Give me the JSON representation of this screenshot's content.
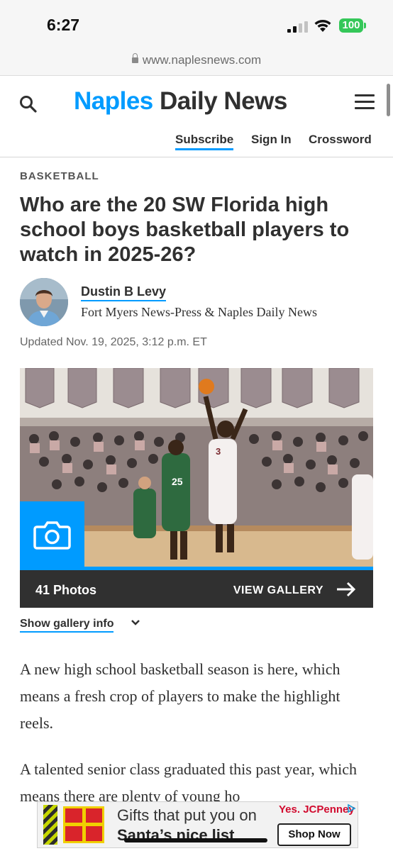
{
  "status_bar": {
    "time": "6:27",
    "battery": "100"
  },
  "browser": {
    "url": "www.naplesnews.com"
  },
  "header": {
    "logo_part1": "Naples",
    "logo_part2": "Daily News",
    "links": {
      "subscribe": "Subscribe",
      "sign_in": "Sign In",
      "crossword": "Crossword"
    }
  },
  "article": {
    "category": "BASKETBALL",
    "headline": "Who are the 20 SW Florida high school boys basketball players to watch in 2025-26?",
    "author": "Dustin B Levy",
    "publication": "Fort Myers News-Press & Naples Daily News",
    "updated": "Updated Nov. 19, 2025, 3:12 p.m. ET",
    "gallery": {
      "count": "41 Photos",
      "view_label": "VIEW GALLERY",
      "info_label": "Show gallery info"
    },
    "paragraphs": [
      "A new high school basketball season is here, which means a fresh crop of players to make the highlight reels.",
      "A talented senior class graduated this past year, which means there are plenty of young ho"
    ]
  },
  "ad": {
    "line1": "Gifts that put you on",
    "line2": "Santa’s nice list",
    "brand": "Yes. JCPenney",
    "cta": "Shop Now"
  },
  "colors": {
    "accent": "#009bff",
    "text": "#303030",
    "gallery_bar": "#303030"
  }
}
